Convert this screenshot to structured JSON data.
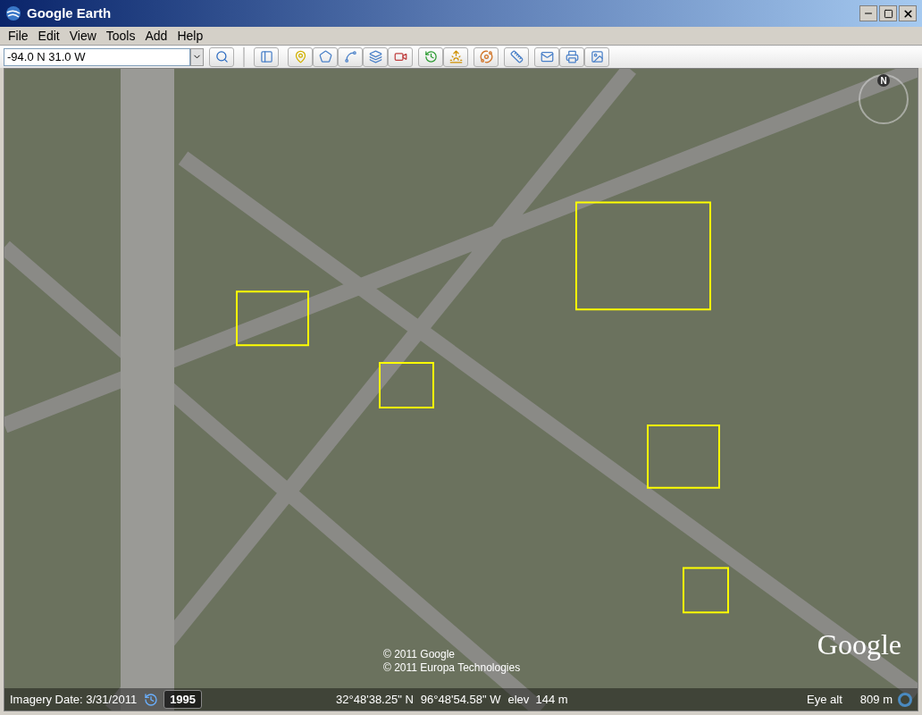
{
  "window": {
    "title": "Google Earth"
  },
  "menu": [
    "File",
    "Edit",
    "View",
    "Tools",
    "Add",
    "Help"
  ],
  "search": {
    "value": "-94.0 N 31.0 W"
  },
  "map": {
    "compass": "N",
    "attribution": [
      "© 2011 Google",
      "© 2011 Europa Technologies"
    ],
    "logo": "Google",
    "status_bar": {
      "imagery_date": "Imagery Date: 3/31/2011",
      "year": "1995",
      "latitude": "32°48'38.25\" N",
      "longitude": "96°48'54.58\" W",
      "elevation": "elev  144 m",
      "eye_alt_label": "Eye alt",
      "eye_alt_value": "809 m"
    }
  }
}
